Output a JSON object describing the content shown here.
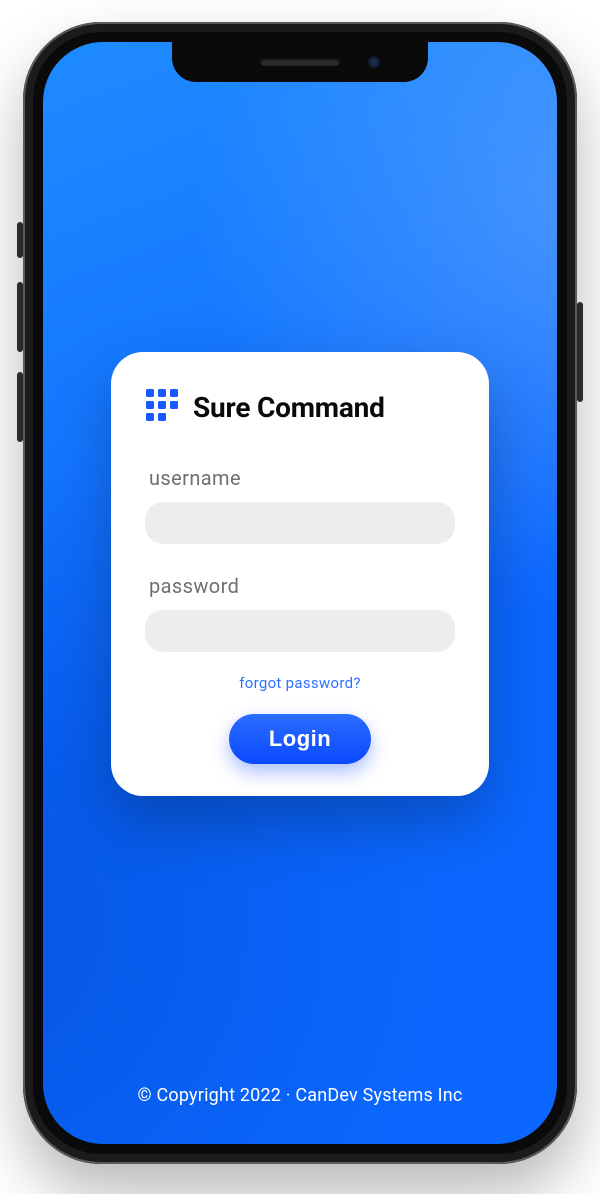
{
  "brand": {
    "name_a": "Sure",
    "name_b": "Command",
    "icon": "grid-dots-icon",
    "icon_color": "#1959ff"
  },
  "form": {
    "username_label": "username",
    "username_value": "",
    "password_label": "password",
    "password_value": "",
    "forgot_text": "forgot password?",
    "login_label": "Login"
  },
  "footer": {
    "text": "© Copyright 2022  ·  CanDev Systems Inc"
  },
  "colors": {
    "accent": "#0b67ff",
    "card_bg": "#ffffff",
    "input_bg": "#ededed",
    "link": "#2f72ff"
  }
}
